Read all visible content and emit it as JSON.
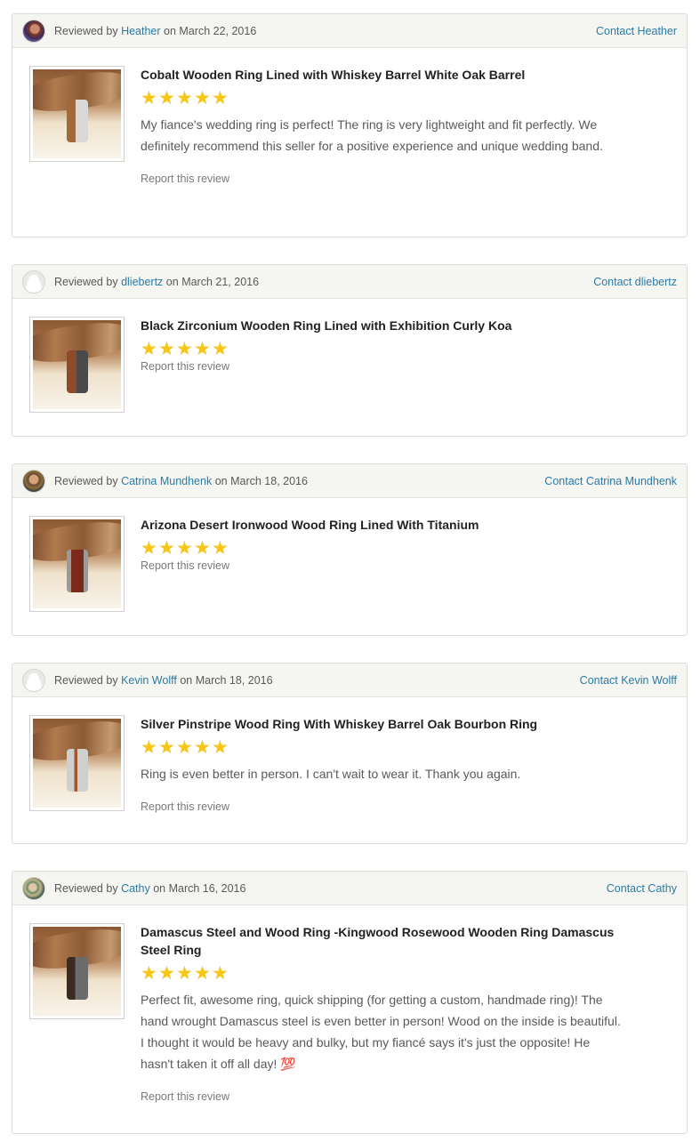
{
  "labels": {
    "reviewed_by": "Reviewed by",
    "on": "on",
    "report": "Report this review",
    "star": "★"
  },
  "reviews": [
    {
      "reviewer": "Heather",
      "date": "March 22, 2016",
      "contact": "Contact Heather",
      "avatar": "photo",
      "product": "Cobalt Wooden Ring Lined with Whiskey Barrel White Oak Barrel",
      "rating": 5,
      "text": "My fiance's wedding ring is perfect! The ring is very lightweight and fit perfectly. We definitely recommend this seller for a positive experience and unique wedding band."
    },
    {
      "reviewer": "dliebertz",
      "date": "March 21, 2016",
      "contact": "Contact dliebertz",
      "avatar": "default-user-icon",
      "product": "Black Zirconium Wooden Ring Lined with Exhibition Curly Koa",
      "rating": 5,
      "text": ""
    },
    {
      "reviewer": "Catrina Mundhenk",
      "date": "March 18, 2016",
      "contact": "Contact Catrina Mundhenk",
      "avatar": "photo",
      "product": "Arizona Desert Ironwood Wood Ring Lined With Titanium",
      "rating": 5,
      "text": ""
    },
    {
      "reviewer": "Kevin Wolff",
      "date": "March 18, 2016",
      "contact": "Contact Kevin Wolff",
      "avatar": "default-user-icon",
      "product": "Silver Pinstripe Wood Ring With Whiskey Barrel Oak Bourbon Ring",
      "rating": 5,
      "text": "Ring is even better in person. I can't wait to wear it. Thank you again."
    },
    {
      "reviewer": "Cathy",
      "date": "March 16, 2016",
      "contact": "Contact Cathy",
      "avatar": "photo",
      "product": "Damascus Steel and Wood Ring -Kingwood Rosewood Wooden Ring Damascus Steel Ring",
      "rating": 5,
      "text": "Perfect fit, awesome ring, quick shipping (for getting a custom, handmade ring)! The hand wrought Damascus steel is even better in person! Wood on the inside is beautiful. I thought it would be heavy and bulky, but my fiancé says it's just the opposite! He hasn't taken it off all day! 💯"
    }
  ],
  "colors": {
    "link": "#2a7ba6",
    "star": "#f5c518",
    "header_bg": "#f5f5f1",
    "border": "#dcdcd7"
  }
}
